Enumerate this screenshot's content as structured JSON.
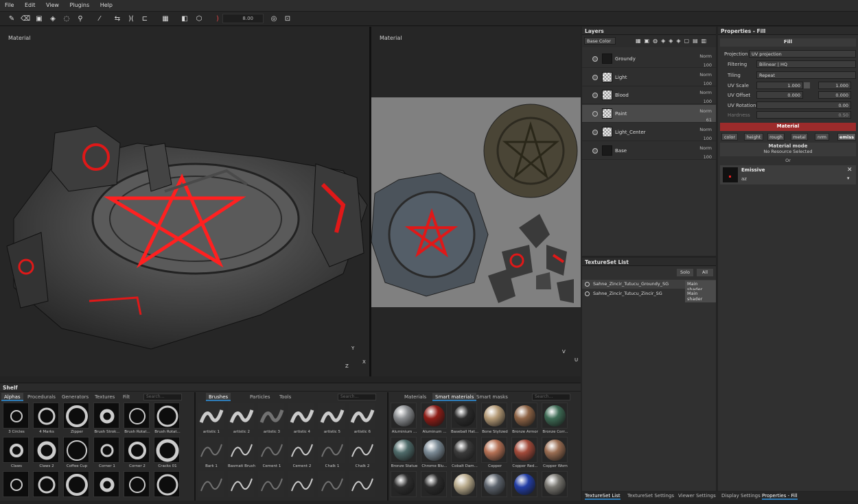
{
  "menu": [
    "File",
    "Edit",
    "View",
    "Plugins",
    "Help"
  ],
  "toolbar": {
    "brush_size": "8.00"
  },
  "viewports": {
    "left_label": "Material",
    "right_label": "Material",
    "left_axes": [
      "Y",
      "Z",
      "X"
    ],
    "right_axes": [
      "V",
      "U"
    ]
  },
  "layers": {
    "title": "Layers",
    "channel": "Base Color",
    "items": [
      {
        "name": "Groundy",
        "mode": "Norm",
        "opacity": "100"
      },
      {
        "name": "Light",
        "mode": "Norm",
        "opacity": "100"
      },
      {
        "name": "Blood",
        "mode": "Norm",
        "opacity": "100"
      },
      {
        "name": "Paint",
        "mode": "Norm",
        "opacity": "61"
      },
      {
        "name": "Light_Center",
        "mode": "Norm",
        "opacity": "100"
      },
      {
        "name": "Base",
        "mode": "Norm",
        "opacity": "100"
      }
    ]
  },
  "textureset": {
    "title": "TextureSet List",
    "solo": "Solo",
    "all": "All",
    "sets": [
      {
        "name": "Sahne_Zincir_Tutucu_Groundy_SG",
        "shader": "Main shader"
      },
      {
        "name": "Sahne_Zincir_Tutucu_Zincir_SG",
        "shader": "Main shader"
      }
    ]
  },
  "properties": {
    "title": "Properties - Fill",
    "fill_header": "Fill",
    "projection_label": "Projection",
    "projection_value": "UV projection",
    "filtering_label": "Filtering",
    "filtering_value": "Bilinear | HQ",
    "tiling_label": "Tiling",
    "tiling_value": "Repeat",
    "uvscale_label": "UV Scale",
    "uvscale_a": "1.000",
    "uvscale_b": "1.000",
    "uvoffset_label": "UV Offset",
    "uvoffset_a": "0.000",
    "uvoffset_b": "0.000",
    "uvrotation_label": "UV Rotation",
    "uvrotation_value": "0.00",
    "hardness_label": "Hardness",
    "hardness_value": "0.50",
    "material_header": "Material",
    "chips": [
      "color",
      "height",
      "rough",
      "metal",
      "nrm",
      "emiss"
    ],
    "material_mode": "Material mode",
    "no_resource": "No Resource Selected",
    "or": "Or",
    "emissive_label": "Emissive",
    "emissive_value": "az"
  },
  "shelf": {
    "title": "Shelf",
    "tabs1": [
      "Alphas",
      "Procedurals",
      "Generators",
      "Textures",
      "Filt"
    ],
    "tabs2": [
      "Brushes",
      "Particles",
      "Tools"
    ],
    "tabs3": [
      "Materials",
      "Smart materials",
      "Smart masks"
    ],
    "search": "Search...",
    "alphas": [
      "3 Circles",
      "4 Marks",
      "Zipper",
      "Brush Strok...",
      "Brush Rotat...",
      "Brush Rotat...",
      "Claws",
      "Claws 2",
      "Coffee Cup",
      "Corner 1",
      "Corner 2",
      "Cracks 01",
      "",
      "",
      "",
      "",
      "",
      ""
    ],
    "brushes": [
      "artistic 1",
      "artistic 2",
      "artistic 3",
      "artistic 4",
      "artistic 5",
      "artistic 6",
      "Bark 1",
      "Basmati Brush",
      "Cement 1",
      "Cement 2",
      "Chalk 1",
      "Chalk 2",
      "",
      "",
      "",
      "",
      "",
      ""
    ],
    "materials": [
      "Aluminium ...",
      "Aluminum ...",
      "Baseball Hat...",
      "Bone Stylized",
      "Bronze Armor",
      "Bronze Corr...",
      "Bronze Statue",
      "Chrome Blu...",
      "Cobalt Dam...",
      "Copper",
      "Copper Red...",
      "Copper Worn",
      "",
      "",
      "",
      "",
      "",
      ""
    ],
    "material_colors": [
      "#8a8d90",
      "#8e1d17",
      "#2a2a2a",
      "#b49a76",
      "#8e6446",
      "#3e6b55",
      "#4f6b6a",
      "#7b8a95",
      "#3b3b3b",
      "#b57155",
      "#a24a3a",
      "#9a6d52",
      "#2e2e2e",
      "#2b2b2b",
      "#b8aa8c",
      "#5d646d",
      "#233ea5",
      "#77756f"
    ]
  },
  "bottom_tabs": [
    "TextureSet List",
    "TextureSet Settings",
    "Viewer Settings",
    "Display Settings",
    "Properties - Fill"
  ]
}
